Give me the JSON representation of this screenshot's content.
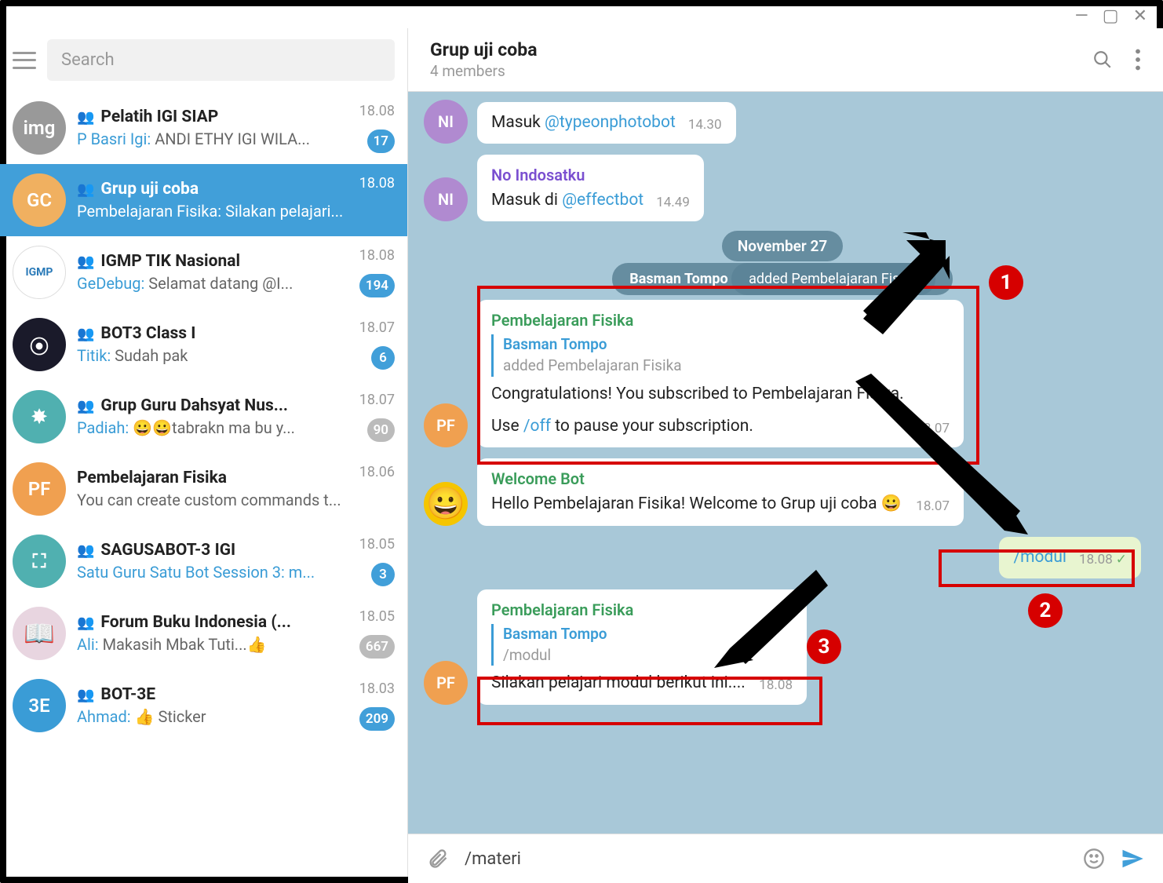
{
  "window_controls": {
    "min": "—",
    "max": "▢",
    "close": "✕"
  },
  "search": {
    "placeholder": "Search"
  },
  "chats": [
    {
      "avatar": "img",
      "title": "Pelatih IGI SIAP",
      "group": true,
      "sender": "P Basri Igi",
      "preview": "ANDI ETHY IGI WILA...",
      "time": "18.08",
      "badge": "17",
      "badge_type": "blue"
    },
    {
      "avatar": "GC",
      "avatar_class": "gc",
      "title": "Grup uji coba",
      "group": true,
      "sender": "Pembelajaran Fisika",
      "preview": "Silakan pelajari...",
      "time": "18.08",
      "selected": true
    },
    {
      "avatar": "IGMP",
      "avatar_class": "igmp",
      "title": "IGMP TIK Nasional",
      "group": true,
      "sender": "GeDebug",
      "preview": "Selamat datang @I...",
      "time": "18.08",
      "badge": "194",
      "badge_type": "blue"
    },
    {
      "avatar": "⦿",
      "avatar_class": "dark",
      "title": "BOT3 Class I",
      "group": true,
      "sender": "Titik",
      "preview": "Sudah pak",
      "time": "18.07",
      "badge": "6",
      "badge_type": "blue"
    },
    {
      "avatar": "✸",
      "avatar_class": "teal",
      "title": "Grup Guru Dahsyat Nus...",
      "group": true,
      "sender": "Padiah",
      "preview": "😀😀tabrakn ma bu y...",
      "time": "18.07",
      "badge": "90",
      "badge_type": "gray"
    },
    {
      "avatar": "PF",
      "avatar_class": "pf",
      "title": "Pembelajaran Fisika",
      "group": false,
      "preview": "You can create custom commands t...",
      "time": "18.06"
    },
    {
      "avatar": "⛶",
      "avatar_class": "teal",
      "title": "SAGUSABOT-3 IGI",
      "group": true,
      "sender": "",
      "preview": "Satu Guru Satu Bot Session 3: m...",
      "preview_blue": true,
      "time": "18.05",
      "badge": "3",
      "badge_type": "blue"
    },
    {
      "avatar": "📖",
      "avatar_class": "book",
      "title": "Forum Buku Indonesia (...",
      "group": true,
      "sender": "Ali",
      "preview": "Makasih Mbak Tuti...👍",
      "time": "18.05",
      "badge": "667",
      "badge_type": "gray"
    },
    {
      "avatar": "3E",
      "avatar_class": "blue",
      "title": "BOT-3E",
      "group": true,
      "sender": "Ahmad",
      "preview": "👍 Sticker",
      "time": "18.03",
      "badge": "209",
      "badge_type": "blue"
    }
  ],
  "header": {
    "title": "Grup uji coba",
    "subtitle": "4 members"
  },
  "date_label": "November 27",
  "system_message": {
    "prefix": "Basman Tompo ",
    "text": "added Pembelajaran Fisika"
  },
  "messages": {
    "m1": {
      "sender": "NI",
      "text_pre": "Masuk ",
      "link": "@typeonphotobot",
      "time": "14.30"
    },
    "m2": {
      "sender": "NI",
      "name": "No Indosatku",
      "text_pre": "Masuk di ",
      "link": "@effectbot",
      "time": "14.49"
    },
    "m3": {
      "name": "Pembelajaran Fisika",
      "reply_name": "Basman Tompo",
      "reply_text": "added Pembelajaran Fisika",
      "body1": "Congratulations! You subscribed to Pembelajaran Fisika.",
      "body2_pre": "Use ",
      "body2_link": "/off",
      "body2_post": " to pause your subscription.",
      "time": "18.07"
    },
    "m4": {
      "name": "Welcome Bot",
      "body": "Hello Pembelajaran Fisika! Welcome to Grup uji coba 😀",
      "time": "18.07"
    },
    "m5": {
      "body": "/modul",
      "time": "18.08"
    },
    "m6": {
      "name": "Pembelajaran Fisika",
      "reply_name": "Basman Tompo",
      "reply_text": "/modul",
      "body": "Silakan pelajari modul berikut ini....",
      "time": "18.08"
    }
  },
  "input": {
    "value": "/materi"
  },
  "annotations": {
    "n1": "1",
    "n2": "2",
    "n3": "3"
  }
}
